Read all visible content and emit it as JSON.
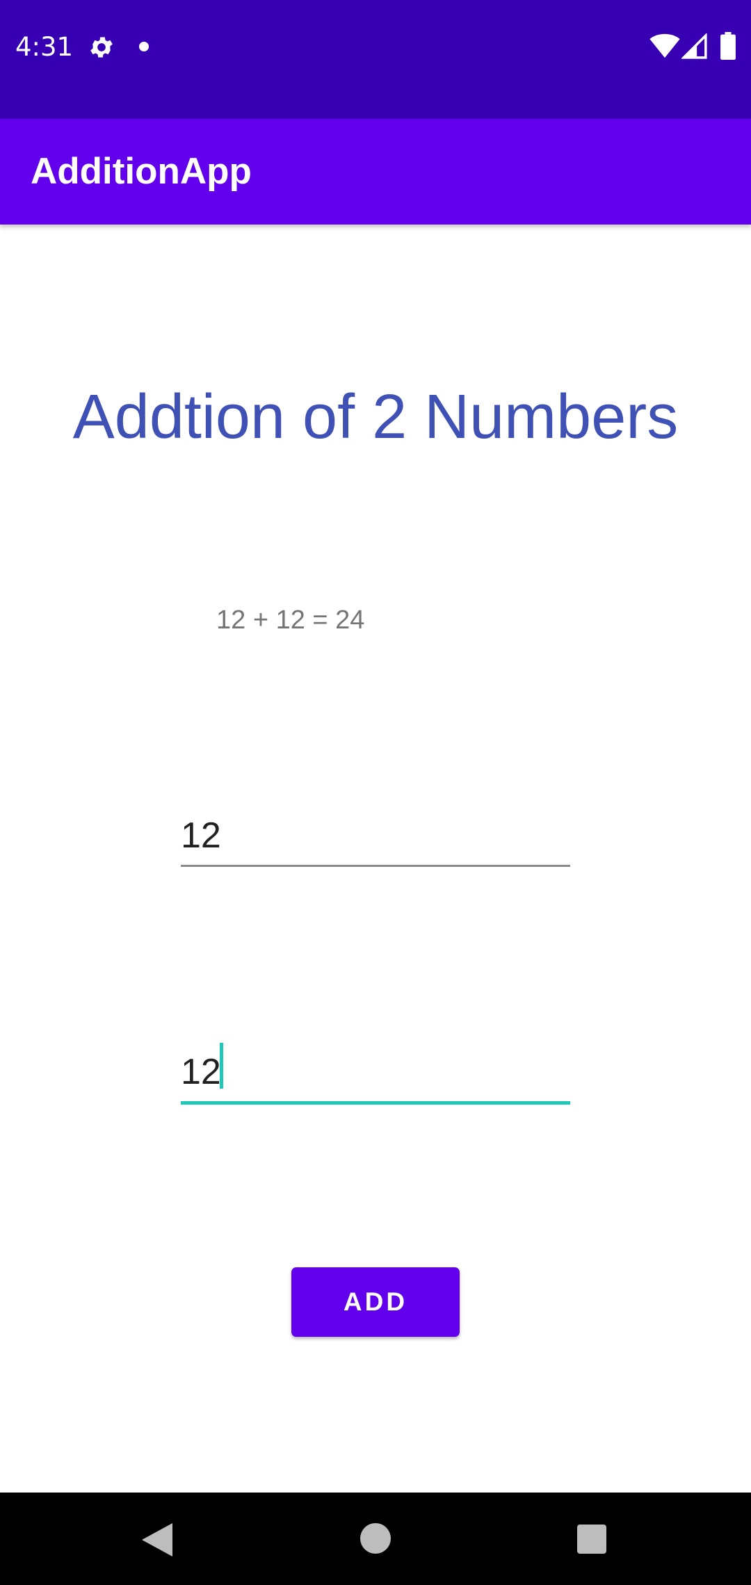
{
  "status_bar": {
    "time": "4:31",
    "icons": [
      "gear-icon",
      "notification-dot-icon",
      "wifi-icon",
      "cell-signal-icon",
      "battery-icon"
    ]
  },
  "app_bar": {
    "title": "AdditionApp",
    "color": "#6200ee"
  },
  "main": {
    "heading": "Addtion of 2 Numbers",
    "result": "12 + 12 = 24",
    "first_number": "12",
    "second_number": "12",
    "add_label": "ADD"
  },
  "nav_bar": {
    "icons": [
      "back-icon",
      "home-icon",
      "recents-icon"
    ]
  },
  "colors": {
    "status_bar": "#3700b3",
    "primary": "#6200ee",
    "heading": "#3f51b5",
    "accent": "#1fc8b8"
  }
}
